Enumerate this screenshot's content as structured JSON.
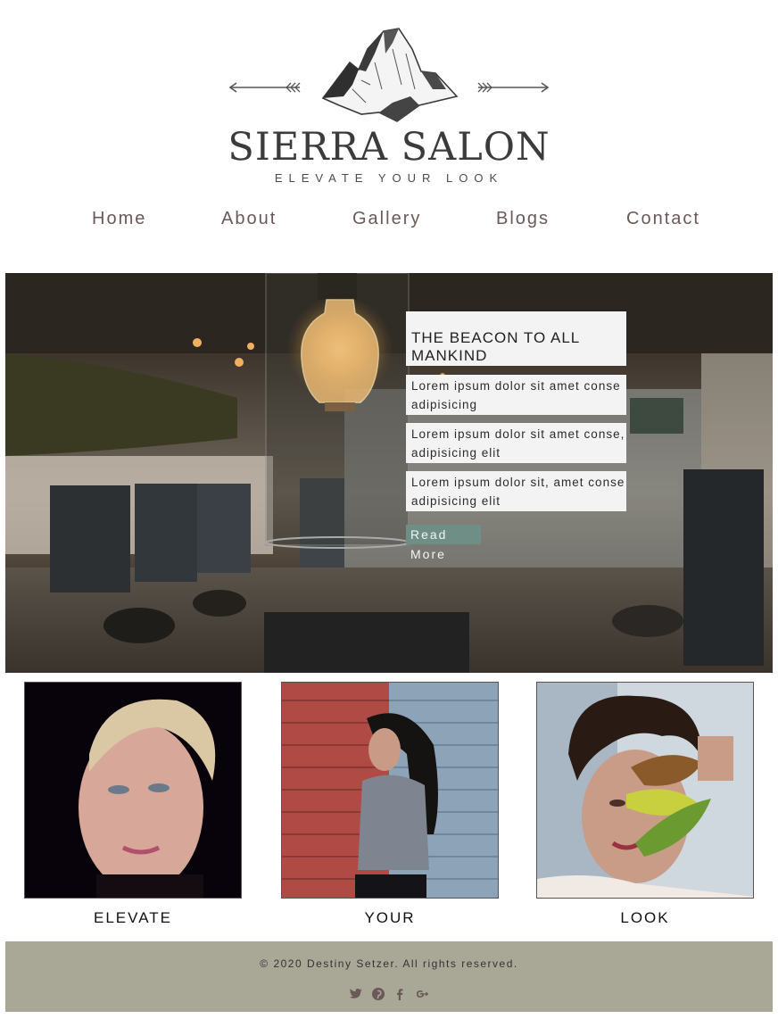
{
  "logo": {
    "title": "SIERRA SALON",
    "tagline": "ELEVATE YOUR LOOK"
  },
  "nav": {
    "items": [
      {
        "label": "Home"
      },
      {
        "label": "About"
      },
      {
        "label": "Gallery"
      },
      {
        "label": "Blogs"
      },
      {
        "label": "Contact"
      }
    ]
  },
  "hero": {
    "card_title": "THE BEACON TO ALL MANKIND",
    "items": [
      {
        "line1": "Lorem ipsum dolor sit amet conse",
        "line2": "adipisicing"
      },
      {
        "line1": "Lorem ipsum dolor sit amet conse,",
        "line2": "adipisicing elit"
      },
      {
        "line1": "Lorem ipsum dolor sit, amet conse",
        "line2": "adipisicing elit"
      }
    ],
    "read_more": "Read More"
  },
  "gallery": {
    "captions": [
      "ELEVATE",
      "YOUR",
      "LOOK"
    ]
  },
  "footer": {
    "copyright": "© 2020 Destiny Setzer. All rights reserved.",
    "social_icons": [
      "twitter-icon",
      "pinterest-icon",
      "facebook-icon",
      "google-plus-icon"
    ]
  },
  "colors": {
    "nav_text": "#6b5858",
    "read_more_bg": "#6f8f86",
    "footer_bg": "#a9a796",
    "social_icon": "#6b5858"
  }
}
